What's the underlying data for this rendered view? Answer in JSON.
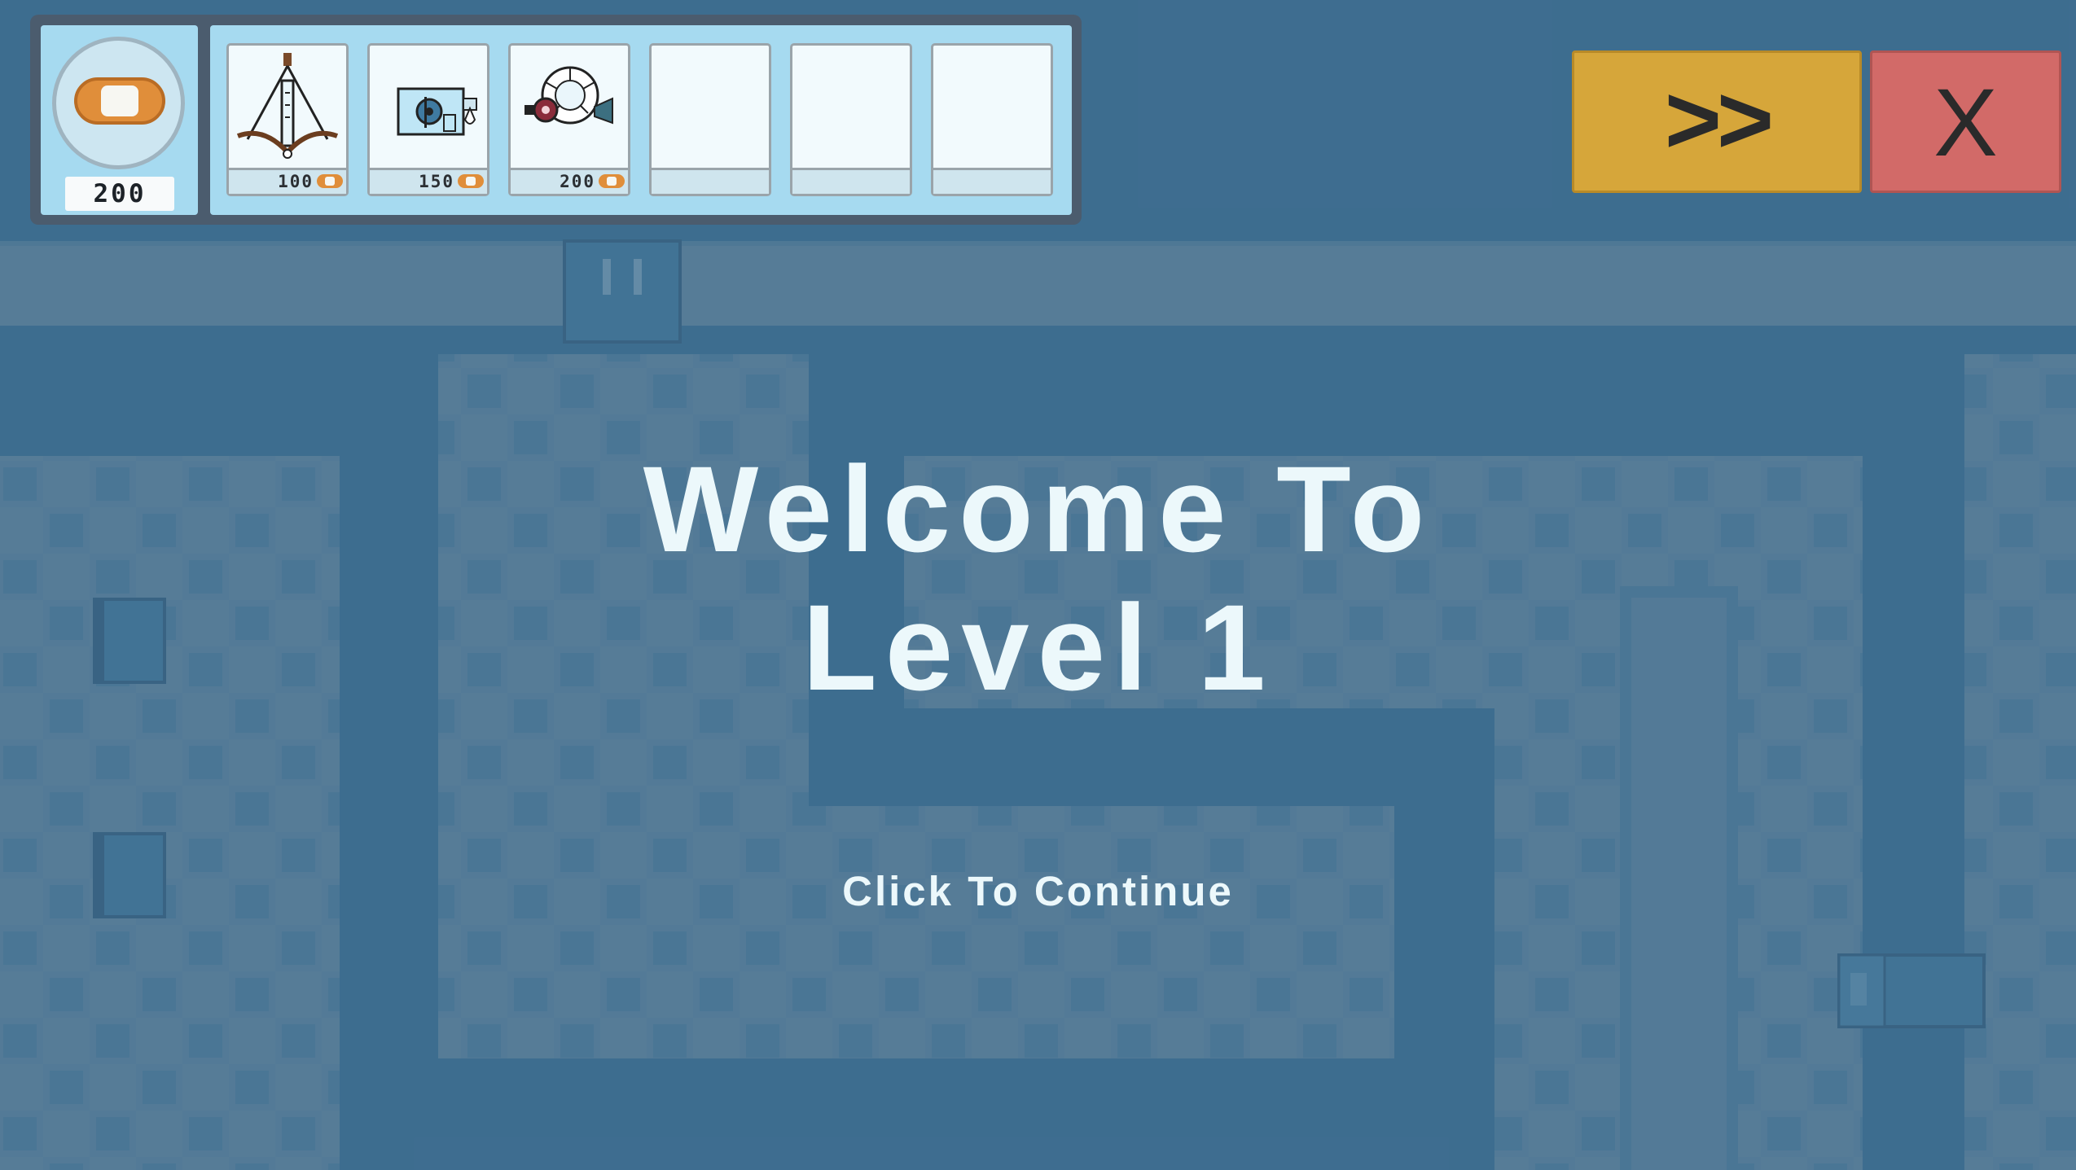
{
  "hud": {
    "currency": {
      "icon": "bandage-coin-icon",
      "amount": "200"
    },
    "shop_slots": [
      {
        "icon": "iv-drip-tower-icon",
        "price": "100",
        "currency_icon": "bandage-coin-icon"
      },
      {
        "icon": "ekg-monitor-tower-icon",
        "price": "150",
        "currency_icon": "bandage-coin-icon"
      },
      {
        "icon": "mri-scanner-tower-icon",
        "price": "200",
        "currency_icon": "bandage-coin-icon"
      },
      {
        "icon": "",
        "price": ""
      },
      {
        "icon": "",
        "price": ""
      },
      {
        "icon": "",
        "price": ""
      }
    ]
  },
  "buttons": {
    "fast_forward_label": ">>",
    "close_label": "X"
  },
  "dialog": {
    "title_line1": "Welcome To",
    "title_line2": "Level 1",
    "continue_label": "Click To Continue"
  },
  "colors": {
    "path": "#2f6287",
    "floor": "#4d7591",
    "floor_checker": "#3f6d8e",
    "fast_forward": "#d6a63a",
    "close": "#d26a68",
    "hud_panel": "#a6daf0",
    "currency": "#e08e3a"
  }
}
